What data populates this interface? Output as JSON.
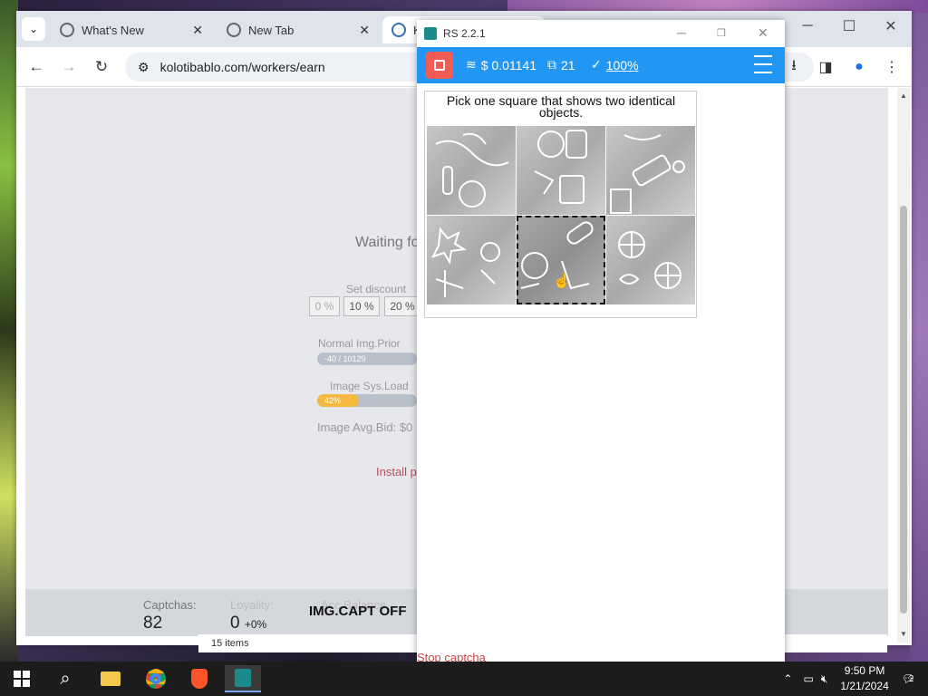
{
  "browser": {
    "tabs": [
      {
        "label": "What's New"
      },
      {
        "label": "New Tab"
      },
      {
        "label": "K"
      }
    ],
    "url": "kolotibablo.com/workers/earn"
  },
  "page": {
    "waiting_text": "Waiting fo",
    "discount_label": "Set discount",
    "discount_options": [
      "0 %",
      "10 %",
      "20 %"
    ],
    "normal_img_priority_label": "Normal Img.Prior",
    "normal_img_priority_value": "-40 / 10129",
    "image_sys_load_label": "Image Sys.Load",
    "image_sys_load_value": "42%",
    "image_sys_load_percent": 42,
    "image_avg_bid": "Image Avg.Bid: $0",
    "install_text": "Install p",
    "stats": {
      "captchas_label": "Captchas:",
      "captchas_value": "82",
      "loyality_label": "Loyality:",
      "loyality_value": "0",
      "loyality_delta": "+0%",
      "acc_balance_label": "Acc.Balance",
      "img_capt": "IMG.CAPT OFF"
    },
    "items_count": "15 items"
  },
  "popup": {
    "title": "RS 2.2.1",
    "balance": "$ 0.01141",
    "count": "21",
    "rate": "100%",
    "captcha_prompt": "Pick one square that shows two identical objects.",
    "bottom_hint": "Stop captcha"
  },
  "taskbar": {
    "time": "9:50 PM",
    "date": "1/21/2024",
    "notifications": "2"
  },
  "colors": {
    "accent": "#2196f3",
    "stop": "#f25c54",
    "load_bar": "#f4b940"
  }
}
